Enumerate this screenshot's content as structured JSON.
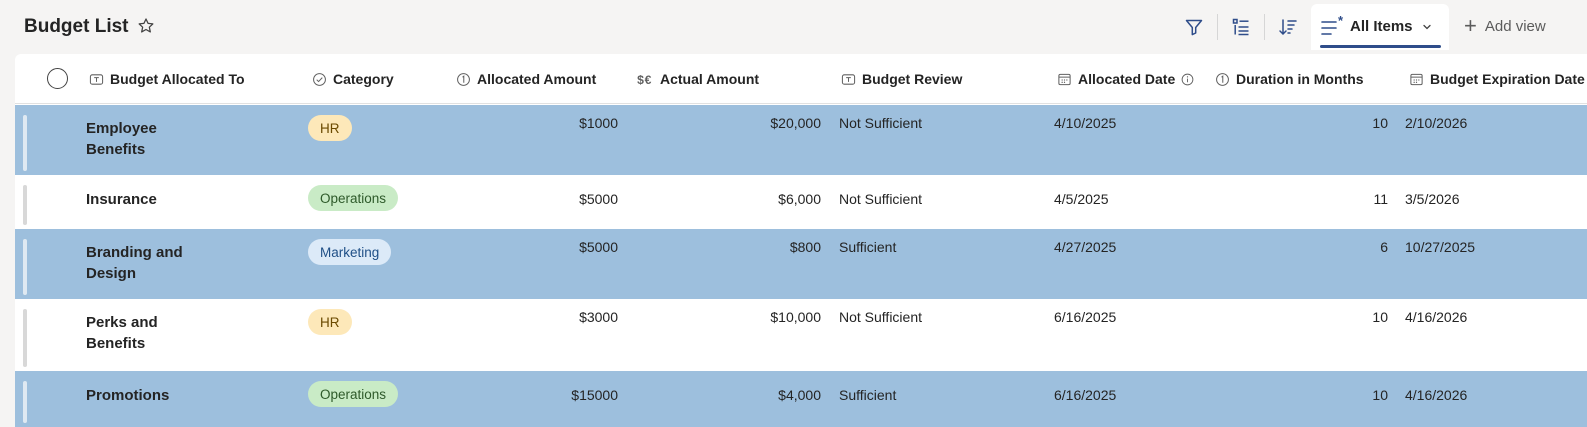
{
  "page": {
    "title": "Budget List"
  },
  "toolbar": {
    "view_label": "All Items",
    "add_view_label": "Add view"
  },
  "columns": [
    {
      "key": "name",
      "label": "Budget Allocated To",
      "icon": "text-icon"
    },
    {
      "key": "category",
      "label": "Category",
      "icon": "choice-icon"
    },
    {
      "key": "allocated",
      "label": "Allocated Amount",
      "icon": "number-icon"
    },
    {
      "key": "actual",
      "label": "Actual Amount",
      "icon": "currency-icon"
    },
    {
      "key": "review",
      "label": "Budget Review",
      "icon": "text-icon"
    },
    {
      "key": "date",
      "label": "Allocated Date",
      "icon": "calendar-icon"
    },
    {
      "key": "duration",
      "label": "Duration in Months",
      "icon": "number-icon"
    },
    {
      "key": "expiry",
      "label": "Budget Expiration Date",
      "icon": "calendar-icon"
    }
  ],
  "category_colors": {
    "HR": {
      "bg": "#fde8b9",
      "fg": "#6b4a00"
    },
    "Operations": {
      "bg": "#c9ebc6",
      "fg": "#2e5a2a"
    },
    "Marketing": {
      "bg": "#dceaf8",
      "fg": "#1f4f86"
    }
  },
  "rows": [
    {
      "selected": true,
      "name": "Employee Benefits",
      "category": "HR",
      "allocated": "$1000",
      "actual": "$20,000",
      "review": "Not Sufficient",
      "date": "4/10/2025",
      "duration": "10",
      "expiry": "2/10/2026"
    },
    {
      "selected": false,
      "name": "Insurance",
      "category": "Operations",
      "allocated": "$5000",
      "actual": "$6,000",
      "review": "Not Sufficient",
      "date": "4/5/2025",
      "duration": "11",
      "expiry": "3/5/2026"
    },
    {
      "selected": true,
      "name": "Branding and Design",
      "category": "Marketing",
      "allocated": "$5000",
      "actual": "$800",
      "review": "Sufficient",
      "date": "4/27/2025",
      "duration": "6",
      "expiry": "10/27/2025"
    },
    {
      "selected": false,
      "name": "Perks and Benefits",
      "category": "HR",
      "allocated": "$3000",
      "actual": "$10,000",
      "review": "Not Sufficient",
      "date": "6/16/2025",
      "duration": "10",
      "expiry": "4/16/2026"
    },
    {
      "selected": true,
      "name": "Promotions",
      "category": "Operations",
      "allocated": "$15000",
      "actual": "$4,000",
      "review": "Sufficient",
      "date": "6/16/2025",
      "duration": "10",
      "expiry": "4/16/2026"
    }
  ]
}
